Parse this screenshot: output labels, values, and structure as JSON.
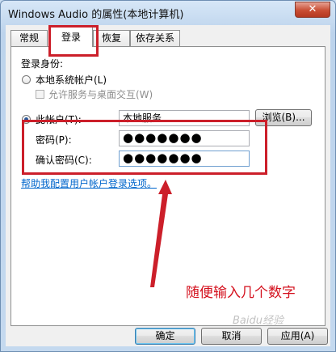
{
  "window": {
    "title": "Windows Audio 的属性(本地计算机)",
    "close": "✕"
  },
  "tabs": [
    {
      "label": "常规",
      "active": false
    },
    {
      "label": "登录",
      "active": true
    },
    {
      "label": "恢复",
      "active": false
    },
    {
      "label": "依存关系",
      "active": false
    }
  ],
  "logon": {
    "section_label": "登录身份:",
    "local_system": {
      "label": "本地系统帐户(L)",
      "checked": false
    },
    "allow_desktop": {
      "label": "允许服务与桌面交互(W)",
      "checked": false,
      "disabled": true
    },
    "this_account": {
      "label": "此帐户(T):",
      "checked": true,
      "value": "本地服务"
    },
    "browse_button": "浏览(B)...",
    "password_label": "密码(P):",
    "password_value": "●●●●●●●",
    "confirm_label": "确认密码(C):",
    "confirm_value": "●●●●●●●",
    "help_link": "帮助我配置用户帐户登录选项。"
  },
  "buttons": {
    "ok": "确定",
    "cancel": "取消",
    "apply": "应用(A)"
  },
  "annotation": {
    "text": "随便输入几个数字",
    "color": "#cc1f2a"
  },
  "watermark": "Baidu经验"
}
